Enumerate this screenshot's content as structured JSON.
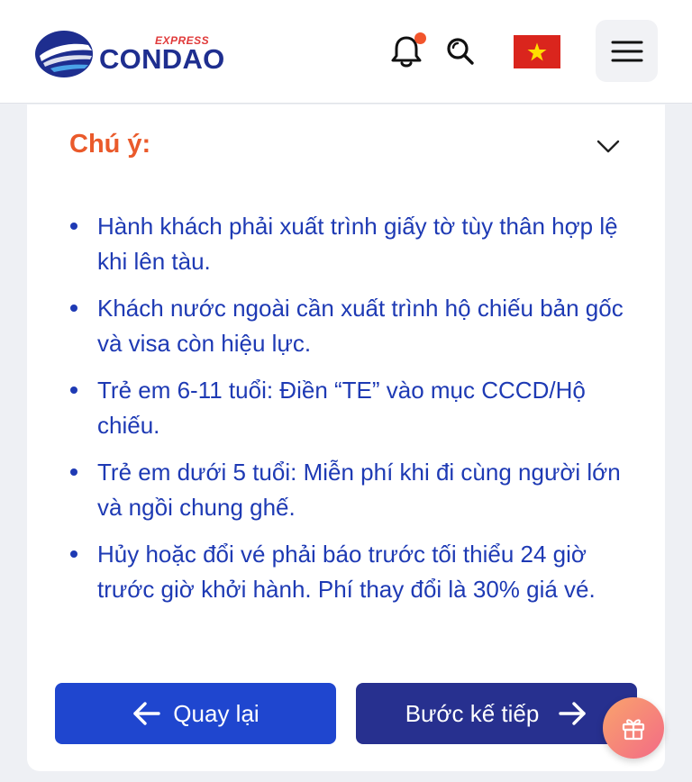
{
  "header": {
    "logo": {
      "brand": "CONDAO",
      "sub": "EXPRESS"
    },
    "icons": [
      "bell-icon",
      "search-icon",
      "vietnam-flag-icon",
      "hamburger-menu-icon"
    ],
    "notification_dot": true
  },
  "notes": {
    "title": "Chú ý:",
    "items": [
      "Hành khách phải xuất trình giấy tờ tùy thân hợp lệ khi lên tàu.",
      "Khách nước ngoài cần xuất trình hộ chiếu bản gốc và visa còn hiệu lực.",
      "Trẻ em 6-11 tuổi: Điền “TE” vào mục CCCD/Hộ chiếu.",
      "Trẻ em dưới 5 tuổi: Miễn phí khi đi cùng người lớn và ngồi chung ghế.",
      "Hủy hoặc đổi vé phải báo trước tối thiểu 24 giờ trước giờ khởi hành. Phí thay đổi là 30% giá vé."
    ]
  },
  "actions": {
    "back_label": "Quay lại",
    "next_label": "Bước kế tiếp"
  },
  "colors": {
    "accent_orange": "#ea5a2b",
    "text_blue": "#1e3ab4",
    "back_button": "#1f46cf",
    "next_button": "#27308f",
    "brand_navy": "#1e2e8f"
  }
}
